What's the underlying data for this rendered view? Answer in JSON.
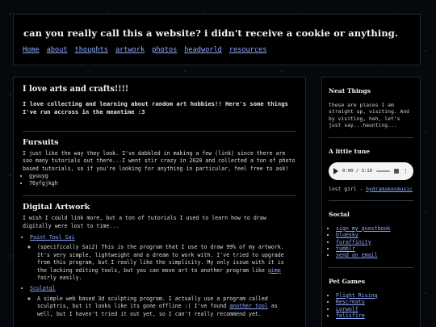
{
  "header": {
    "title": "can you really call this a website? i didn't receive a cookie or anything.",
    "nav": [
      "Home",
      "about",
      "thoughts",
      "artwork",
      "photos",
      "headworld",
      "resources"
    ]
  },
  "main": {
    "heading": "I love arts and crafts!!!!",
    "intro": "I love collecting and learning about random art hobbies!! Here's some things I've run accross in the meantime :3",
    "fursuits": {
      "heading": "Fursuits",
      "text": "I just like the way they look. I've dabbled in making a few (link) since there are soo many tutorials out there...I went stir crazy in 2020 and collected a ton of photo based tutorials, so if you're looking for anything in particular, feel free to ask!",
      "items": [
        "gyuuyg",
        "76yfgjkgh"
      ]
    },
    "digital": {
      "heading": "Digital Artwork",
      "text": "I wish I could link more, but a ton of tutorials I used to learn how to draw digitally were lost to time...",
      "tools": [
        {
          "name": "Paint Tool Sai",
          "desc_before": "(specifically Sai2) This is the program that I use to draw 99% of my artwork. It's very simple, lightweight and a dream to work with. I've tried to upgrade from this program, but I really like the simplicity. My only issue with it is the lacking editing tools, but you can move art to another program like ",
          "link": "gimp",
          "desc_after": " fairly easily."
        },
        {
          "name": "Sculptgl",
          "desc_before": "A simple web based 3d sculpting program. I actually use a program called sculptris, but it looks like its gone offline :( I've found ",
          "link": "another tool",
          "desc_after": " as well, but I haven't tried it out yet, so I can't really recommend yet."
        }
      ]
    }
  },
  "sidebar": {
    "neat_things": {
      "heading": "Neat Things",
      "text": "these are places I am straight up, visiting. And by visiting, heh, let's just say...haunting..."
    },
    "tune": {
      "heading": "A little tune",
      "time": "0:00 / 3:10",
      "caption_prefix": "lost girl - ",
      "caption_link": "hydramakesmusic"
    },
    "social": {
      "heading": "Social",
      "links": [
        "sign my guestbook",
        "bluesky",
        "furaffinity",
        "tumblr",
        "send an email"
      ]
    },
    "pet_games": {
      "heading": "Pet Games",
      "links": [
        "Flight Rising",
        "Rescreatu",
        "Lorwolf",
        "felisfire"
      ]
    }
  }
}
